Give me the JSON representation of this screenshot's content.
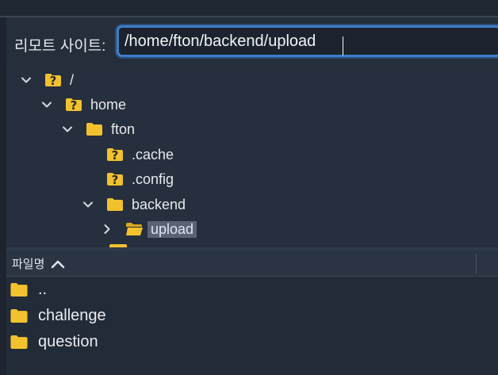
{
  "address": {
    "label": "리모트 사이트:",
    "value": "/home/fton/backend/upload"
  },
  "tree": {
    "items": [
      {
        "label": "/",
        "icon": "unknown-folder-icon",
        "expanded": true
      },
      {
        "label": "home",
        "icon": "unknown-folder-icon",
        "expanded": true
      },
      {
        "label": "fton",
        "icon": "folder-icon",
        "expanded": true
      },
      {
        "label": ".cache",
        "icon": "unknown-folder-icon"
      },
      {
        "label": ".config",
        "icon": "unknown-folder-icon"
      },
      {
        "label": "backend",
        "icon": "folder-icon",
        "expanded": true
      },
      {
        "label": "upload",
        "icon": "open-folder-icon",
        "expanded": false,
        "selected": true
      }
    ]
  },
  "list": {
    "column_filename": "파일명",
    "sort": "ascending",
    "rows": [
      {
        "name": "..",
        "icon": "folder-icon"
      },
      {
        "name": "challenge",
        "icon": "folder-icon"
      },
      {
        "name": "question",
        "icon": "folder-icon"
      }
    ]
  },
  "colors": {
    "folder": "#f2c12e",
    "focus_ring": "#3f7dc8",
    "selection": "#5a6375",
    "background": "#222b38"
  }
}
